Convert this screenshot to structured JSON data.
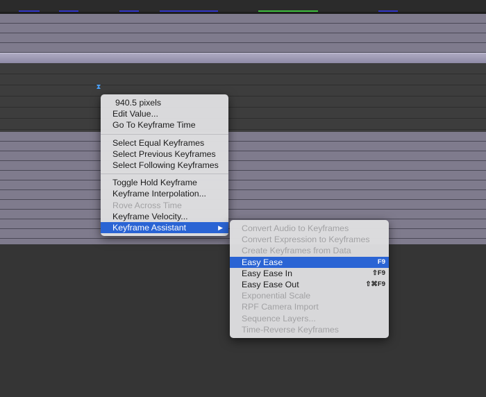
{
  "colors": {
    "menu_bg": "#dedee0",
    "selected_bg": "#2a64d4",
    "ruler_blue": "#3236c8",
    "ruler_green": "#3fbf3f",
    "keyframe_marker": "#4aa3ff"
  },
  "icons": {
    "keyframe_marker": "hourglass-keyframe-icon",
    "submenu_arrow": "triangle-right-icon"
  },
  "context_menu": {
    "header_value": "940.5 pixels",
    "items": [
      {
        "label": "Edit Value...",
        "enabled": true
      },
      {
        "label": "Go To Keyframe Time",
        "enabled": true
      },
      {
        "label": "Select Equal Keyframes",
        "enabled": true
      },
      {
        "label": "Select Previous Keyframes",
        "enabled": true
      },
      {
        "label": "Select Following Keyframes",
        "enabled": true
      },
      {
        "label": "Toggle Hold Keyframe",
        "enabled": true
      },
      {
        "label": "Keyframe Interpolation...",
        "enabled": true
      },
      {
        "label": "Rove Across Time",
        "enabled": false
      },
      {
        "label": "Keyframe Velocity...",
        "enabled": true
      },
      {
        "label": "Keyframe Assistant",
        "enabled": true,
        "selected": true,
        "arrow": "▶"
      }
    ]
  },
  "submenu": {
    "items": [
      {
        "label": "Convert Audio to Keyframes",
        "enabled": false
      },
      {
        "label": "Convert Expression to Keyframes",
        "enabled": false
      },
      {
        "label": "Create Keyframes from Data",
        "enabled": false
      },
      {
        "label": "Easy Ease",
        "enabled": true,
        "selected": true,
        "shortcut": "F9"
      },
      {
        "label": "Easy Ease In",
        "enabled": true,
        "shortcut": "⇧F9"
      },
      {
        "label": "Easy Ease Out",
        "enabled": true,
        "shortcut": "⇧⌘F9"
      },
      {
        "label": "Exponential Scale",
        "enabled": false
      },
      {
        "label": "RPF Camera Import",
        "enabled": false
      },
      {
        "label": "Sequence Layers...",
        "enabled": false
      },
      {
        "label": "Time-Reverse Keyframes",
        "enabled": false
      }
    ]
  }
}
